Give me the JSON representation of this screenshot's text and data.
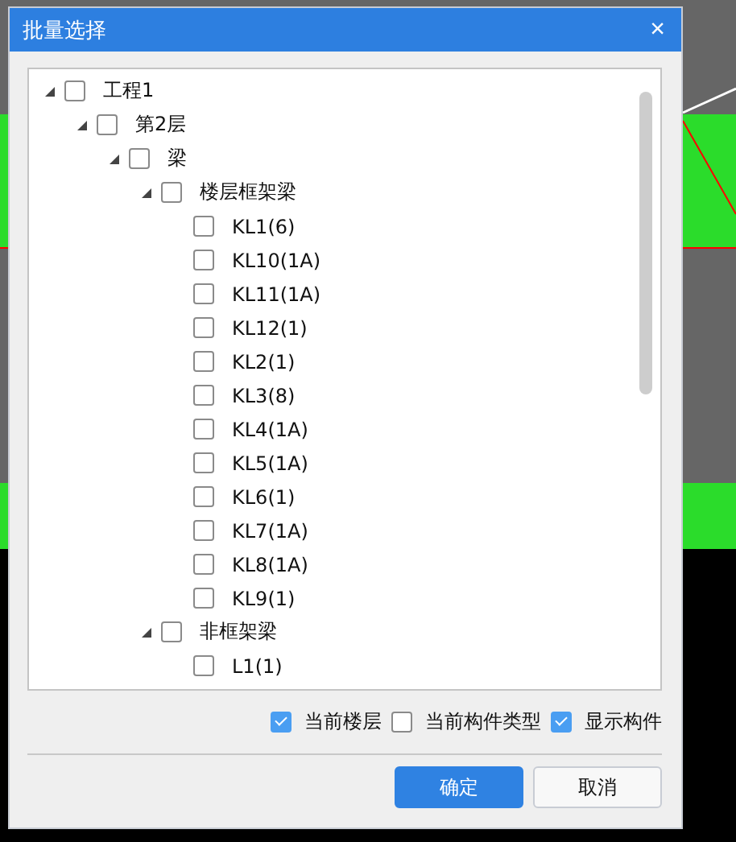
{
  "dialog": {
    "title": "批量选择",
    "close": "×"
  },
  "tree": [
    {
      "label": "工程1",
      "expanded": true,
      "checked": false,
      "children": [
        {
          "label": "第2层",
          "expanded": true,
          "checked": false,
          "children": [
            {
              "label": "梁",
              "expanded": true,
              "checked": false,
              "children": [
                {
                  "label": "楼层框架梁",
                  "expanded": true,
                  "checked": false,
                  "children": [
                    {
                      "label": "KL1(6)",
                      "checked": false
                    },
                    {
                      "label": "KL10(1A)",
                      "checked": false
                    },
                    {
                      "label": "KL11(1A)",
                      "checked": false
                    },
                    {
                      "label": "KL12(1)",
                      "checked": false
                    },
                    {
                      "label": "KL2(1)",
                      "checked": false
                    },
                    {
                      "label": "KL3(8)",
                      "checked": false
                    },
                    {
                      "label": "KL4(1A)",
                      "checked": false
                    },
                    {
                      "label": "KL5(1A)",
                      "checked": false
                    },
                    {
                      "label": "KL6(1)",
                      "checked": false
                    },
                    {
                      "label": "KL7(1A)",
                      "checked": false
                    },
                    {
                      "label": "KL8(1A)",
                      "checked": false
                    },
                    {
                      "label": "KL9(1)",
                      "checked": false
                    }
                  ]
                },
                {
                  "label": "非框架梁",
                  "expanded": true,
                  "checked": false,
                  "children": [
                    {
                      "label": "L1(1)",
                      "checked": false
                    }
                  ]
                }
              ]
            }
          ]
        }
      ]
    }
  ],
  "options": [
    {
      "label": "当前楼层",
      "checked": true
    },
    {
      "label": "当前构件类型",
      "checked": false
    },
    {
      "label": "显示构件",
      "checked": true
    }
  ],
  "buttons": [
    {
      "label": "确定",
      "kind": "primary"
    },
    {
      "label": "取消",
      "kind": "secondary"
    }
  ]
}
